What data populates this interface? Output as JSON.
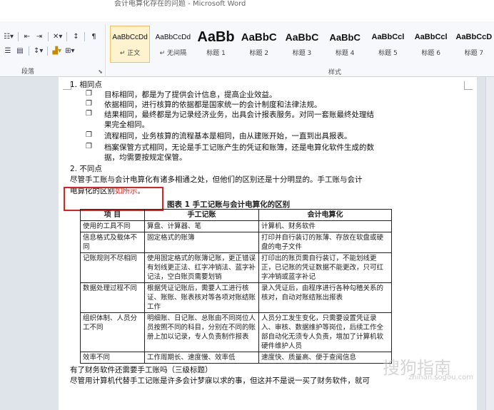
{
  "window": {
    "title": "会计电算化存在的问题 - Microsoft Word"
  },
  "ribbon": {
    "paragraph_label": "段落",
    "styles_label": "样式",
    "styles": [
      {
        "sample": "AaBbCcDd",
        "name": "↵ 正文"
      },
      {
        "sample": "AaBbCcDd",
        "name": "↵ 无间隔"
      },
      {
        "sample": "AaBb",
        "name": "标题 1"
      },
      {
        "sample": "AaBbC",
        "name": "标题 2"
      },
      {
        "sample": "AaBbC",
        "name": "标题 3"
      },
      {
        "sample": "AaBbC",
        "name": "标题 4"
      },
      {
        "sample": "AaBbCcl",
        "name": "标题 5"
      },
      {
        "sample": "AaBbCcl",
        "name": "标题 6"
      },
      {
        "sample": "AaBbCcD",
        "name": "标题 7"
      }
    ]
  },
  "document": {
    "section1_title": "1. 相同点",
    "bullets": [
      "目标相同，都是为了提供会计信息，提高企业效益。",
      "依据相同，进行核算的依据都是国家统一的会计制度和法律法规。",
      "结果相同，最终都是为记录经济业务，出具会计报表服务。对同一套账最终处理结",
      "果完全相同。",
      "流程相同，业务核算的流程基本是相同，由从建账开始，一直到出具报表。",
      "档案保管方式相同，无论是手工记账产生的凭证和账簿，还是电算化软件生成的数",
      "据，均需要按规定保管。"
    ],
    "section2_title": "2. 不同点",
    "diff_line1": "尽管手工账与会计电算化有诸多相通之处，但他们的区别还是十分明显的。手工账与会计",
    "diff_line2_a": "电算化的区别",
    "diff_line2_b": "如所示。",
    "caption": "图表 1 手工记账与会计电算化的区别",
    "table": {
      "headers": [
        "项  目",
        "手工记账",
        "会计电算化"
      ],
      "rows": [
        [
          "使用的工具不同",
          "算盘、计算器、笔",
          "计算机、财务软件"
        ],
        [
          "信息格式及载体不同",
          "固定格式的账簿",
          "打印并自行装订的账薄、存放在软盘或硬盘的电子文件"
        ],
        [
          "记账规则不尽相同",
          "使用固定格式的账簿记账，更正错误有划线更正法、红字冲销法、蓝字补记法，空白账页需要划销",
          "打印出的账页需自行装订，不能划线更正，已记账的凭证数据不能更改，只可红字冲销或蓝字补记"
        ],
        [
          "数据处理过程不同",
          "根据凭证记账后，需要人工进行核证、账账、账表核对等各项对账结账工作",
          "录入凭证后，由程序进行各种勾稽关系的核对，自动对账结账出报表"
        ],
        [
          "组织体制、人员分工不同",
          "明细账、日记账、总账由不同岗位人员按照不同的科目，分别在不同的账册上加以记录，专人负责制作报表",
          "人员分工发生变化，只需要设置凭证录入、审核、数据维护等岗位，后续工作全部自动化无须专人负责，增加了计算机软硬件维护人员"
        ],
        [
          "效率不同",
          "工作周期长、速度慢、效率低",
          "速度快、质量高、便于查阅信息"
        ]
      ]
    },
    "after_line1": "有了财务软件还需要手工账吗（三级标题）",
    "after_line2": "尽管用计算机代替手工记账是许多会计梦寐以求的事，但这并不是说一买了财务软件，就可"
  },
  "watermark": {
    "text": "搜狗指南",
    "sub": "zhinan.sogou.com"
  }
}
